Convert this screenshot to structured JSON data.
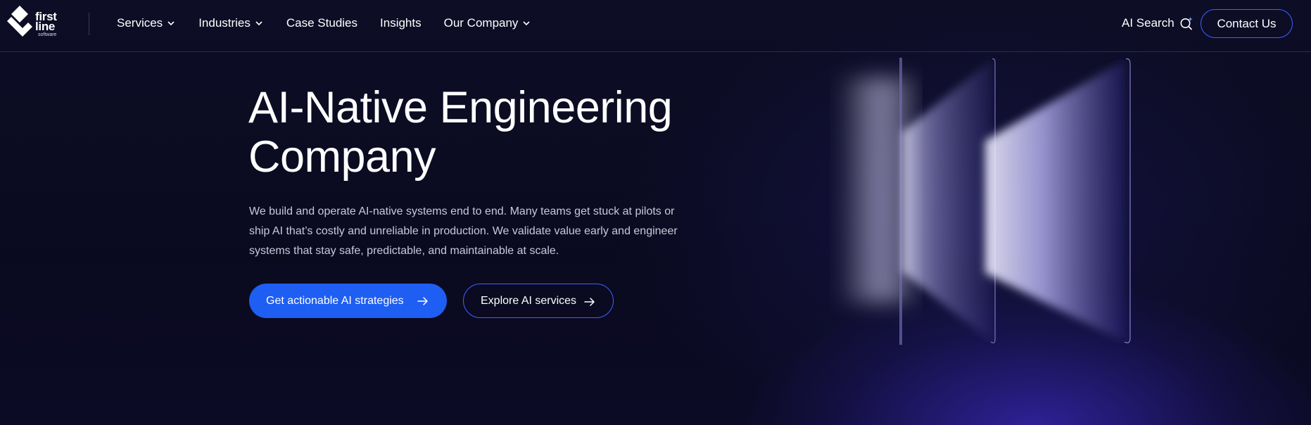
{
  "logo": {
    "line1": "first",
    "line2": "line",
    "line3": "software",
    "icon": "first-line-logo-mark"
  },
  "nav": {
    "items": [
      {
        "label": "Services",
        "dropdown": true
      },
      {
        "label": "Industries",
        "dropdown": true
      },
      {
        "label": "Case Studies",
        "dropdown": false
      },
      {
        "label": "Insights",
        "dropdown": false
      },
      {
        "label": "Our Company",
        "dropdown": true
      }
    ],
    "ai_search_label": "AI Search",
    "ai_search_icon": "sparkle-search-icon",
    "contact_label": "Contact Us"
  },
  "hero": {
    "title_line1": "AI-Native Engineering",
    "title_line2": "Company",
    "description_line1": "We build and operate AI-native systems end to end. Many teams get stuck at pilots or",
    "description_line2": "ship AI that’s costly and unreliable in production. We validate value early and engineer",
    "description_line3": "systems that stay safe, predictable, and maintainable at scale.",
    "primary_cta": "Get actionable AI strategies",
    "secondary_cta": "Explore AI services",
    "cta_icon": "arrow-right-icon"
  },
  "colors": {
    "background": "#0b0b22",
    "accent_blue": "#1e5ef2",
    "outline_blue": "#3a63ff",
    "glow_purple": "#3a28be",
    "text_muted": "#c9c9dc"
  }
}
